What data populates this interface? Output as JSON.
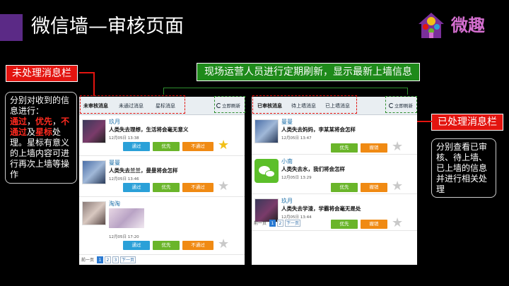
{
  "header": {
    "title": "微信墙—审核页面",
    "brand_name": "微趣",
    "accent_color": "#5b2a86"
  },
  "callouts": {
    "unprocessed_label": "未处理消息栏",
    "processed_label": "已处理消息栏",
    "refresh_note": "现场运营人员进行定期刷新，显示最新上墙信息"
  },
  "notes": {
    "left": {
      "line1": "分别对收到的信息进行：",
      "pass": "通过",
      "sep1": "，",
      "priority": "优先",
      "sep2": "，",
      "reject": "不通过",
      "and": "及",
      "star": "星标",
      "rest": "处理。星标有意义的上墙内容可进行再次上墙等操作"
    },
    "right": "分别查看已审核、待上墙、已上墙的信息并进行相关处理"
  },
  "left_panel": {
    "tabs": [
      "未审核消息",
      "未通过消息",
      "星标消息"
    ],
    "refresh_label": "立即刷新",
    "items": [
      {
        "user": "玖月",
        "text": "人类失去理想，生活将会毫无意义",
        "time": "12月05日 13:38",
        "buttons": [
          "通过",
          "优先",
          "不通过"
        ],
        "starred": true
      },
      {
        "user": "曼曼",
        "text": "人类失去兰兰，曼曼将会怎样",
        "time": "12月05日 13:46",
        "buttons": [
          "通过",
          "优先",
          "不通过"
        ],
        "starred": false
      },
      {
        "user": "淘淘",
        "text": "",
        "time": "12月05日 17:20",
        "buttons": [
          "通过",
          "优先",
          "不通过"
        ],
        "starred": false
      }
    ],
    "pager": {
      "prev": "前一页",
      "pages": [
        "1",
        "2",
        "3"
      ],
      "next": "下一页"
    }
  },
  "right_panel": {
    "tabs": [
      "已审核消息",
      "待上墙消息",
      "已上墙消息"
    ],
    "refresh_label": "立即刷新",
    "items": [
      {
        "user": "曼曼",
        "text": "人类失去妈妈，李某某将会怎样",
        "time": "12月05日 13:47",
        "buttons": [
          "优先",
          "撤销"
        ]
      },
      {
        "user": "小南",
        "text": "人类失去水，我们将会怎样",
        "time": "12月05日 13:29",
        "buttons": [
          "优先",
          "撤销"
        ]
      },
      {
        "user": "玖月",
        "text": "人类失去学渣，学霸将会毫无是处",
        "time": "12月05日 13:44",
        "buttons": [
          "优先",
          "撤销"
        ]
      }
    ],
    "pager": {
      "prev": "前一页",
      "pages": [
        "1",
        "2"
      ],
      "next": "下一页"
    }
  }
}
